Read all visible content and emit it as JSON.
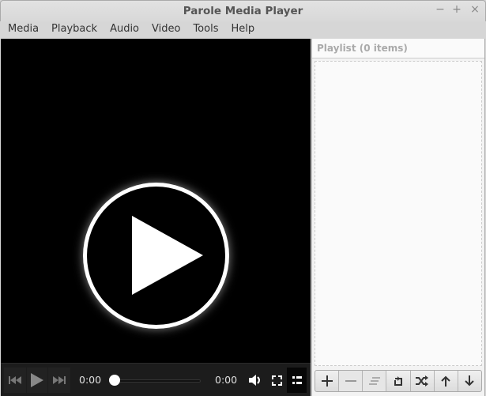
{
  "window": {
    "title": "Parole Media Player",
    "minimize": "−",
    "maximize": "+",
    "close": "×"
  },
  "menu": [
    "Media",
    "Playback",
    "Audio",
    "Video",
    "Tools",
    "Help"
  ],
  "controls": {
    "current_time": "0:00",
    "total_time": "0:00",
    "progress": 0
  },
  "playlist": {
    "header": "Playlist (0 items)"
  }
}
